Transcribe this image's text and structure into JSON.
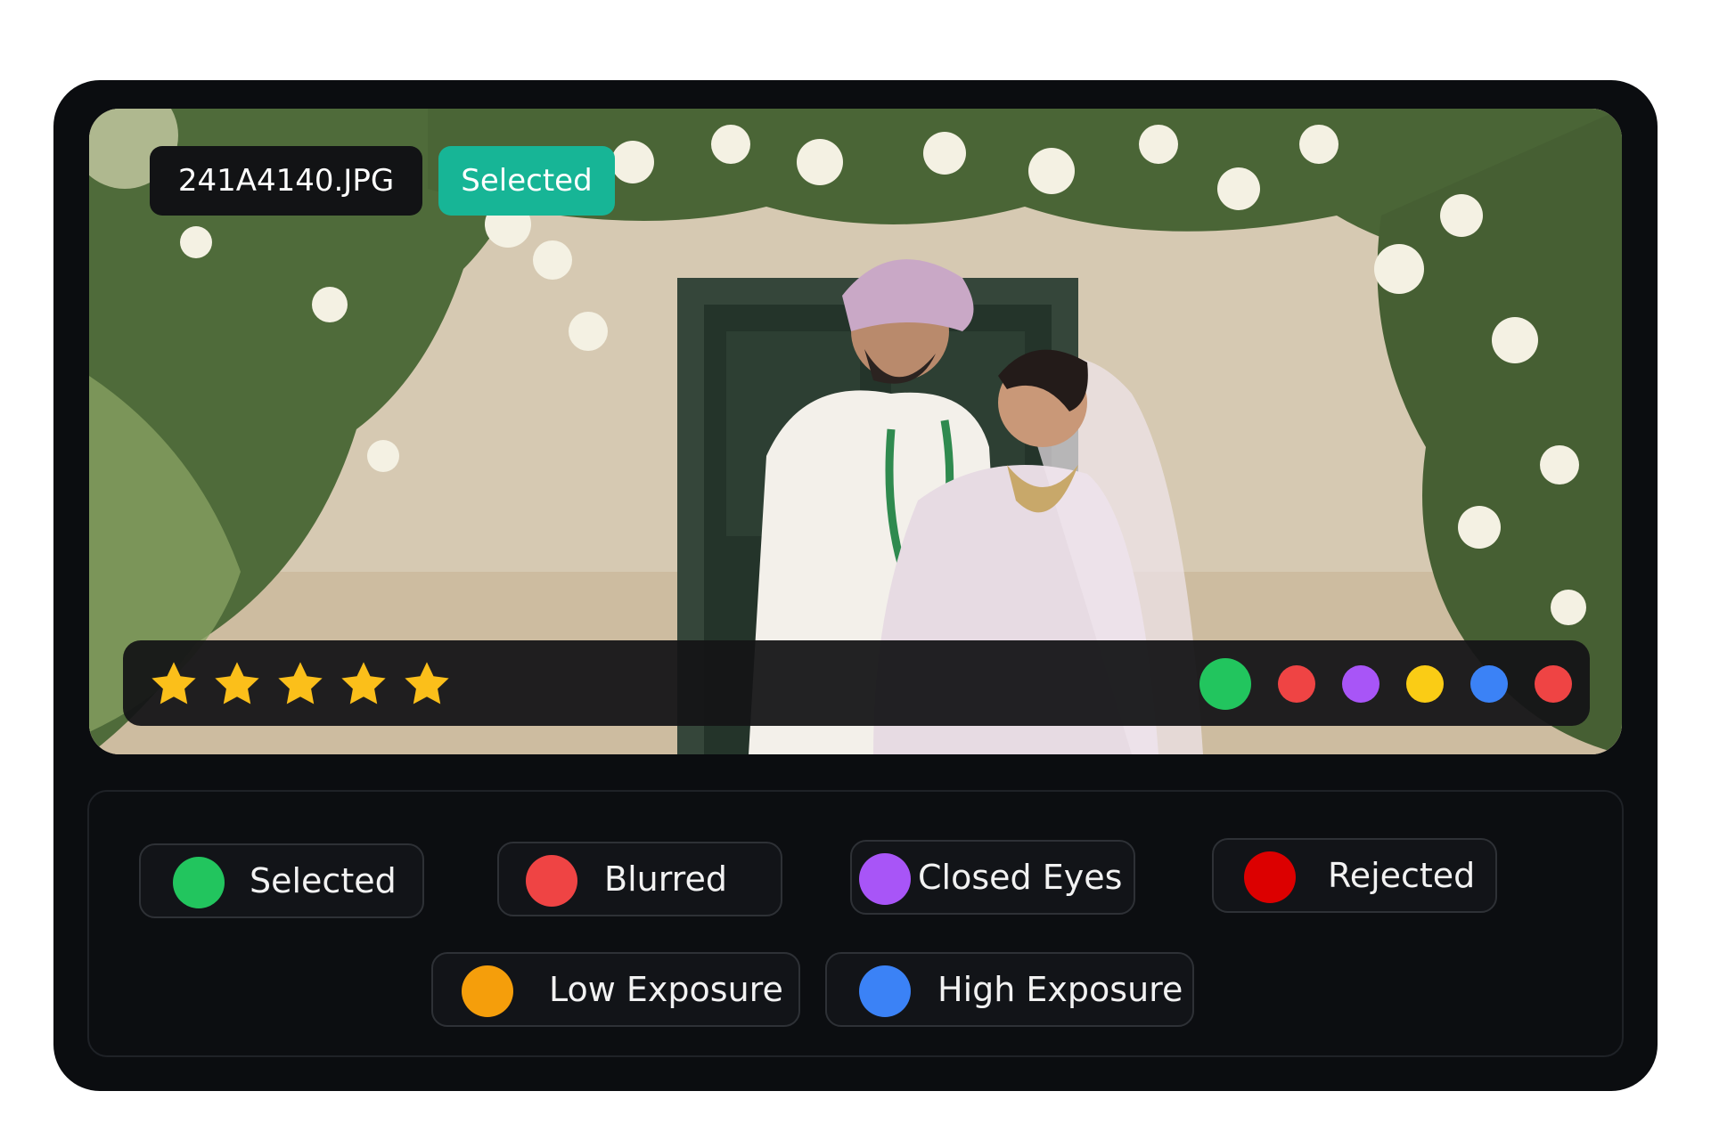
{
  "photo": {
    "filename": "241A4140.JPG",
    "status_label": "Selected",
    "status_color": "#17b596",
    "rating": 5,
    "rating_max": 5,
    "star_color": "#fbbf1a",
    "color_tags": [
      {
        "name": "green-tag",
        "color": "#22c55e"
      },
      {
        "name": "red-tag",
        "color": "#ef4444"
      },
      {
        "name": "purple-tag",
        "color": "#a855f7"
      },
      {
        "name": "yellow-tag",
        "color": "#facc15"
      },
      {
        "name": "blue-tag",
        "color": "#3b82f6"
      },
      {
        "name": "red-tag-2",
        "color": "#ef4444"
      }
    ]
  },
  "legend": [
    {
      "label": "Selected",
      "color": "#22c55e"
    },
    {
      "label": "Blurred",
      "color": "#ef4444"
    },
    {
      "label": "Closed Eyes",
      "color": "#a855f7"
    },
    {
      "label": "Rejected",
      "color": "#dc0000"
    },
    {
      "label": "Low Exposure",
      "color": "#f59e0b"
    },
    {
      "label": "High Exposure",
      "color": "#3b82f6"
    }
  ]
}
